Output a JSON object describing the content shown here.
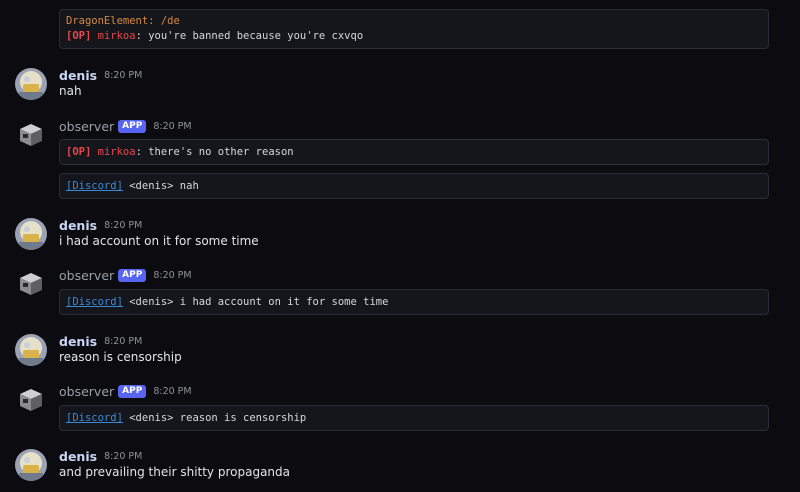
{
  "messages": {
    "m0": {
      "line1": "DragonElement: /de",
      "op_tag": "[OP]",
      "nick": "mirkoa",
      "text": ": you're banned because you're cxvqo"
    },
    "m1": {
      "author": "denis",
      "time": "8:20 PM",
      "text": "nah"
    },
    "m2": {
      "author": "observer",
      "badge": "APP",
      "time": "8:20 PM",
      "block1": {
        "op_tag": "[OP]",
        "nick": "mirkoa",
        "text": ": there's no other reason"
      },
      "block2": {
        "tag": "[Discord]",
        "text": " <denis> nah"
      }
    },
    "m3": {
      "author": "denis",
      "time": "8:20 PM",
      "text": "i had account on it for some time"
    },
    "m4": {
      "author": "observer",
      "badge": "APP",
      "time": "8:20 PM",
      "block1": {
        "tag": "[Discord]",
        "text": " <denis> i had account on it for some time"
      }
    },
    "m5": {
      "author": "denis",
      "time": "8:20 PM",
      "text": "reason is censorship"
    },
    "m6": {
      "author": "observer",
      "badge": "APP",
      "time": "8:20 PM",
      "block1": {
        "tag": "[Discord]",
        "text": " <denis> reason is censorship"
      }
    },
    "m7": {
      "author": "denis",
      "time": "8:20 PM",
      "text": "and prevailing their shitty propaganda"
    }
  },
  "colors": {
    "background": "#0c0c10",
    "app_badge": "#5865f2",
    "op_red": "#e5484d",
    "link_blue": "#3b8bd6",
    "orange": "#d78a3f"
  }
}
